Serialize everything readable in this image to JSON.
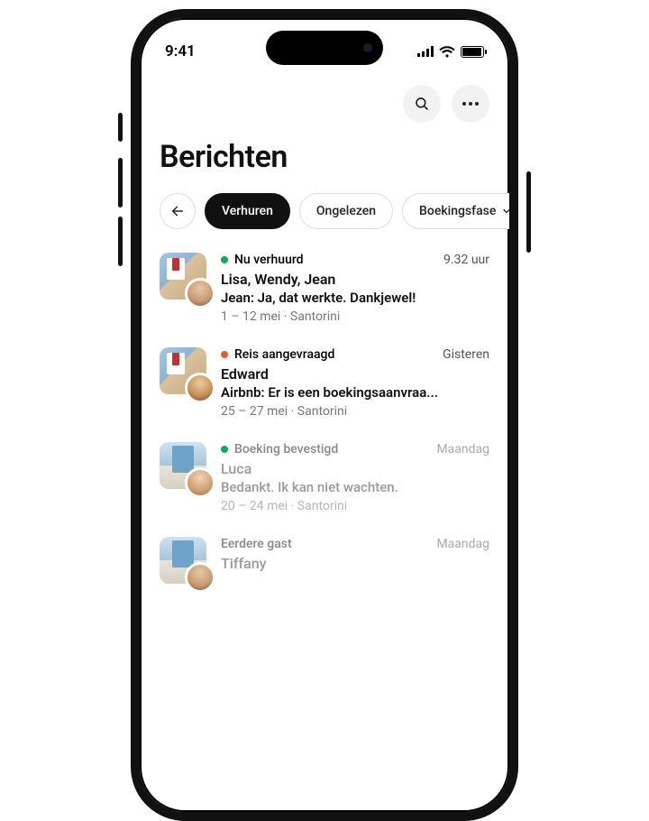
{
  "status_bar": {
    "time": "9:41"
  },
  "header": {
    "title": "Berichten",
    "search_label": "search",
    "more_label": "more"
  },
  "filters": {
    "back_label": "back",
    "chips": [
      {
        "label": "Verhuren",
        "active": true,
        "dropdown": false
      },
      {
        "label": "Ongelezen",
        "active": false,
        "dropdown": false
      },
      {
        "label": "Boekingsfase",
        "active": false,
        "dropdown": true
      }
    ]
  },
  "threads": [
    {
      "status_label": "Nu verhuurd",
      "status_color": "green",
      "timestamp": "9.32 uur",
      "names": "Lisa, Wendy, Jean",
      "preview": "Jean: Ja, dat werkte. Dankjewel!",
      "meta": "1 – 12 mei  · Santorini",
      "read": false,
      "thumb": "santorini",
      "avatar": "a1"
    },
    {
      "status_label": "Reis aangevraagd",
      "status_color": "orange",
      "timestamp": "Gisteren",
      "names": "Edward",
      "preview": "Airbnb: Er is een boekingsaanvraa...",
      "meta": "25 – 27 mei · Santorini",
      "read": false,
      "thumb": "santorini",
      "avatar": "a2"
    },
    {
      "status_label": "Boeking bevestigd",
      "status_color": "green",
      "timestamp": "Maandag",
      "names": "Luca",
      "preview": "Bedankt. Ik kan niet wachten.",
      "meta": "20 – 24 mei · Santorini",
      "read": true,
      "thumb": "blue",
      "avatar": "a3"
    },
    {
      "status_label": "Eerdere gast",
      "status_color": "none",
      "timestamp": "Maandag",
      "names": "Tiffany",
      "preview": "",
      "meta": "",
      "read": true,
      "thumb": "blue",
      "avatar": "a1"
    }
  ]
}
